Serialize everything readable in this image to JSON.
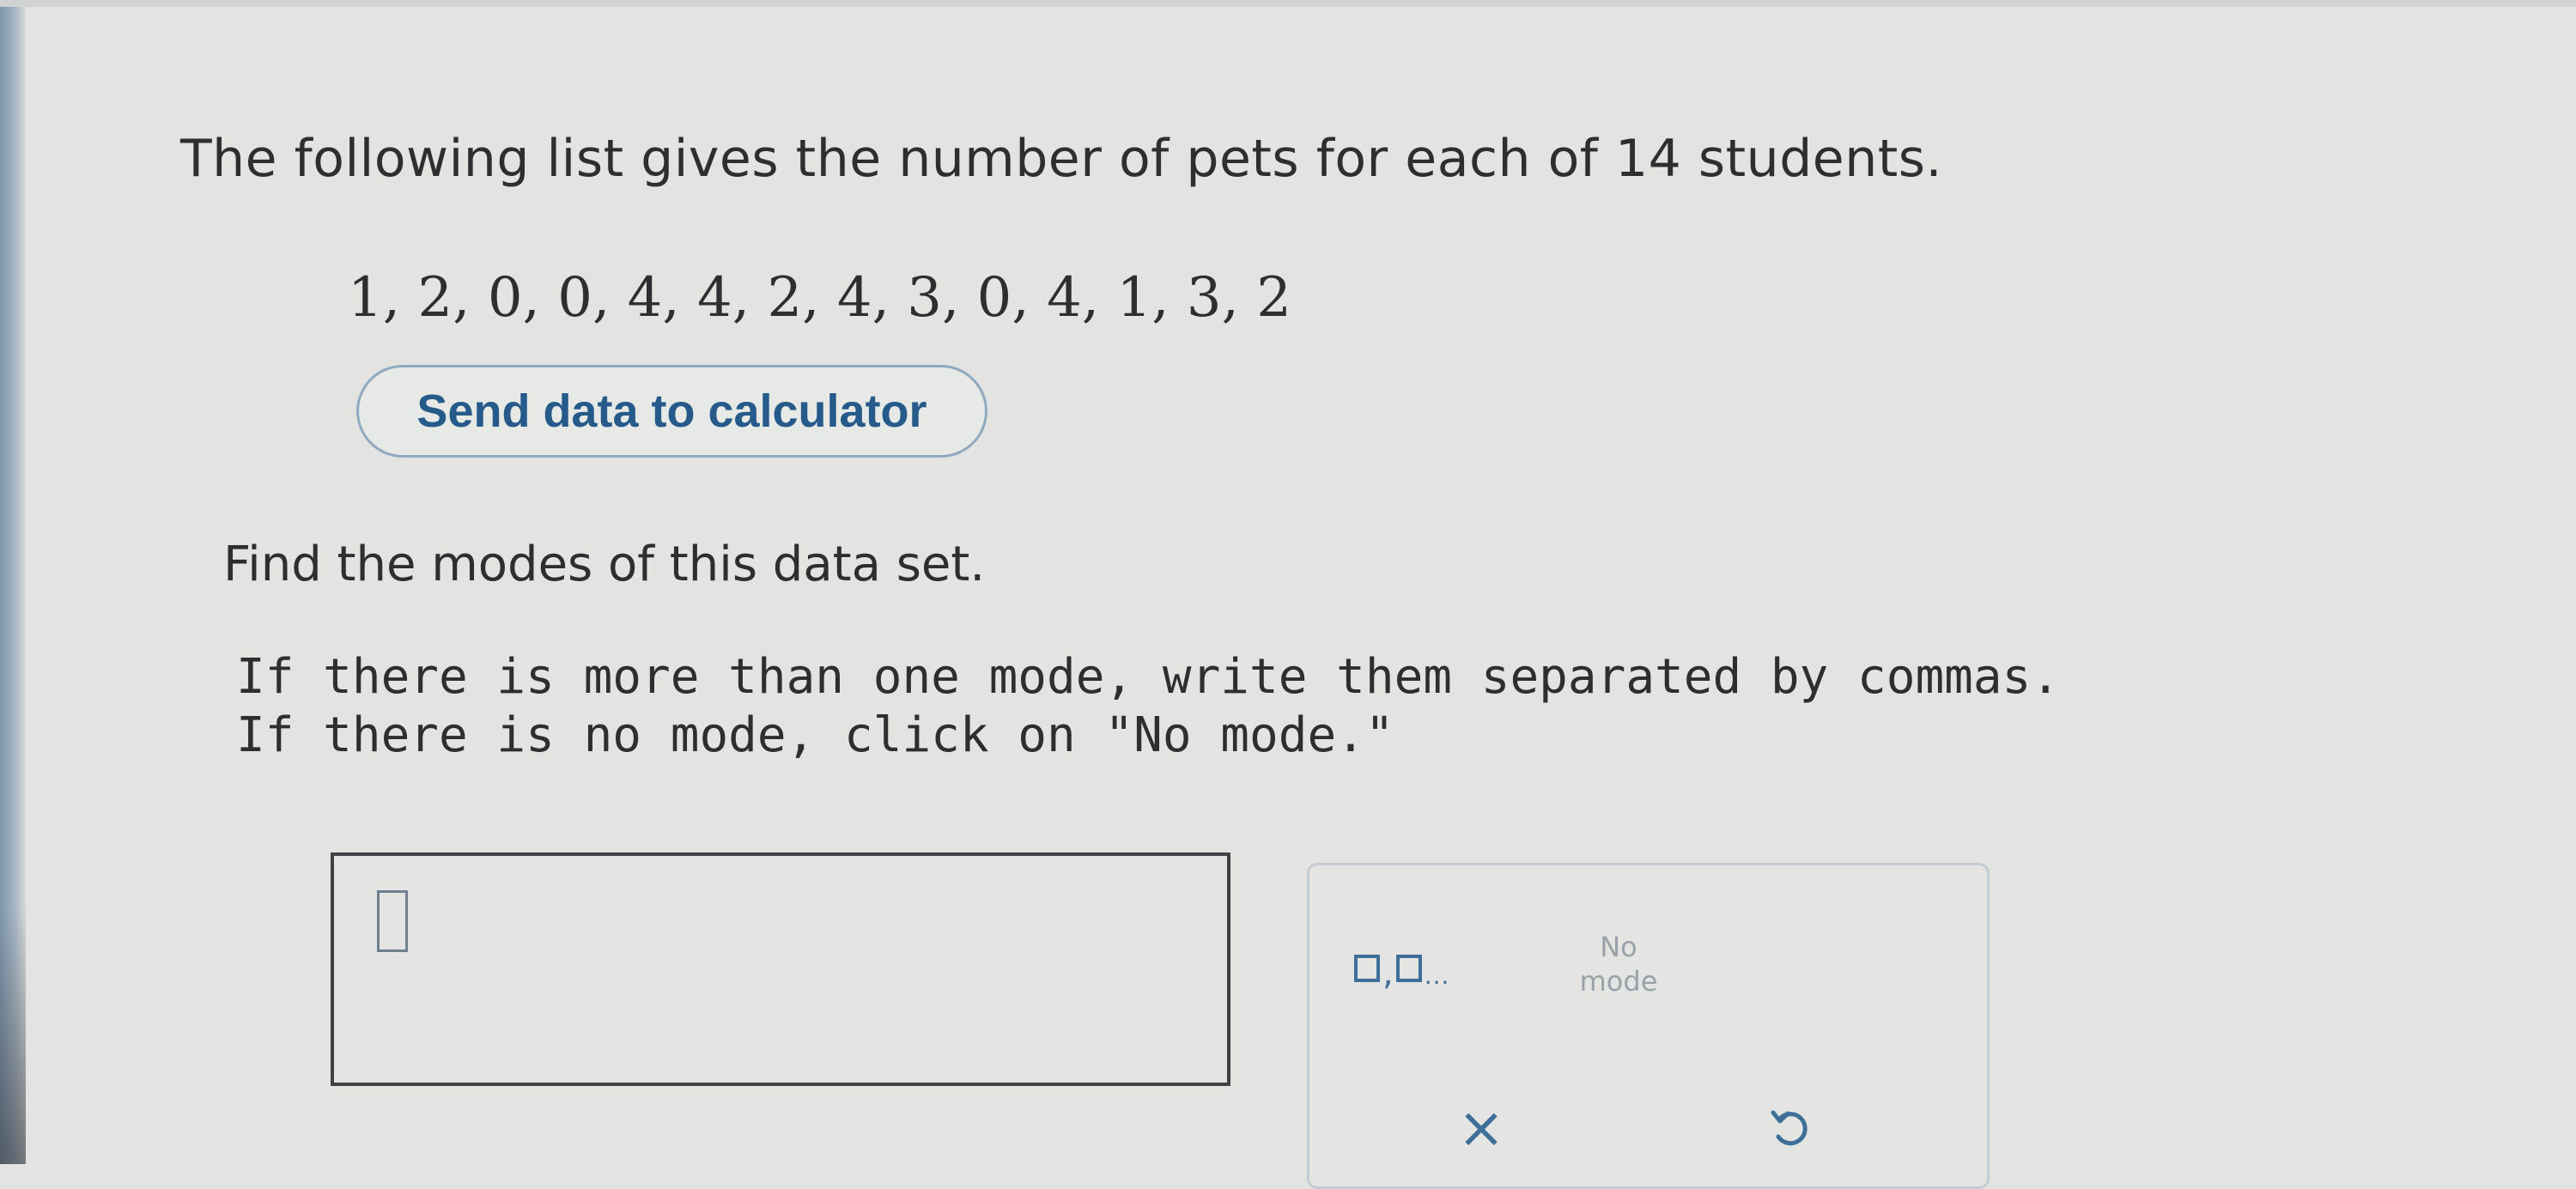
{
  "question": {
    "text": "The following list gives the number of pets for each of 14 students."
  },
  "data_list": {
    "text": "1, 2, 0, 0, 4, 4, 2, 4, 3, 0, 4, 1, 3, 2"
  },
  "send_button": {
    "label": "Send data to calculator"
  },
  "prompt": {
    "text": "Find the modes of this data set."
  },
  "instructions": {
    "line1": "If there is more than one mode, write them separated by commas.",
    "line2": "If there is no mode, click on \"No mode.\""
  },
  "answer_field": {
    "value": ""
  },
  "keypad": {
    "multi_comma": ",",
    "multi_dots": "...",
    "no_mode_line1": "No",
    "no_mode_line2": "mode",
    "clear_symbol": "×",
    "icons": {
      "multi_answer": "two-boxes-comma-icon",
      "clear": "close-icon",
      "undo": "undo-icon"
    }
  },
  "colors": {
    "accent": "#3d6f98",
    "button_text": "#255a8a",
    "button_border": "#8fa9bf",
    "background": "#e3e4e1",
    "text": "#2c2e30",
    "disabled": "#9aa2a9"
  }
}
